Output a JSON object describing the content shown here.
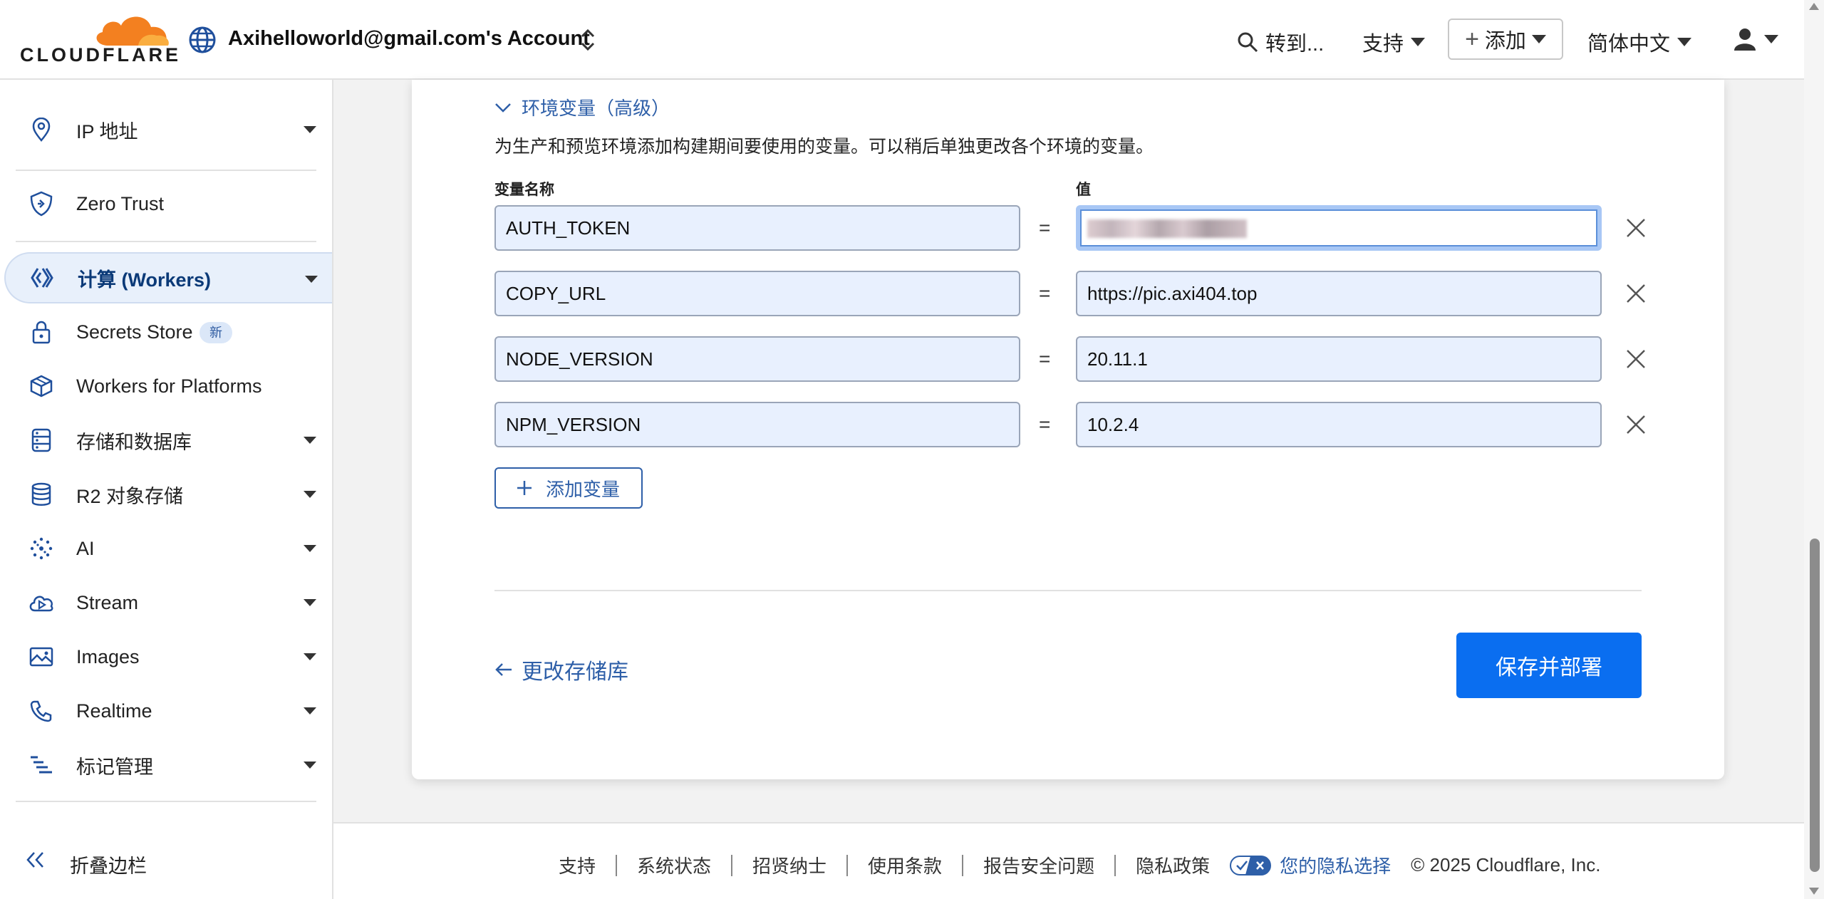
{
  "header": {
    "logo_text": "CLOUDFLARE",
    "account_name": "Axihelloworld@gmail.com's Account",
    "goto_label": "转到...",
    "support_label": "支持",
    "add_label": "添加",
    "language_label": "简体中文"
  },
  "sidebar": {
    "items": [
      {
        "label": "IP 地址"
      },
      {
        "label": "Zero Trust"
      },
      {
        "label": "计算 (Workers)"
      },
      {
        "label": "Secrets Store",
        "badge": "新"
      },
      {
        "label": "Workers for Platforms"
      },
      {
        "label": "存储和数据库"
      },
      {
        "label": "R2 对象存储"
      },
      {
        "label": "AI"
      },
      {
        "label": "Stream"
      },
      {
        "label": "Images"
      },
      {
        "label": "Realtime"
      },
      {
        "label": "标记管理"
      }
    ],
    "collapse_label": "折叠边栏"
  },
  "env": {
    "toggle_label": "环境变量（高级）",
    "description": "为生产和预览环境添加构建期间要使用的变量。可以稍后单独更改各个环境的变量。",
    "col_name": "变量名称",
    "col_value": "值",
    "equals": "=",
    "rows": [
      {
        "name": "AUTH_TOKEN",
        "value": ""
      },
      {
        "name": "COPY_URL",
        "value": "https://pic.axi404.top"
      },
      {
        "name": "NODE_VERSION",
        "value": "20.11.1"
      },
      {
        "name": "NPM_VERSION",
        "value": "10.2.4"
      }
    ],
    "add_variable_label": "添加变量"
  },
  "actions": {
    "back_label": "更改存储库",
    "save_label": "保存并部署"
  },
  "footer": {
    "links": [
      "支持",
      "系统状态",
      "招贤纳士",
      "使用条款",
      "报告安全问题",
      "隐私政策"
    ],
    "privacy_choices": "您的隐私选择",
    "copyright": "© 2025 Cloudflare, Inc."
  },
  "colors": {
    "brand_orange": "#f38020",
    "link_blue": "#2e5fa8",
    "primary_button": "#0a6ef0"
  }
}
